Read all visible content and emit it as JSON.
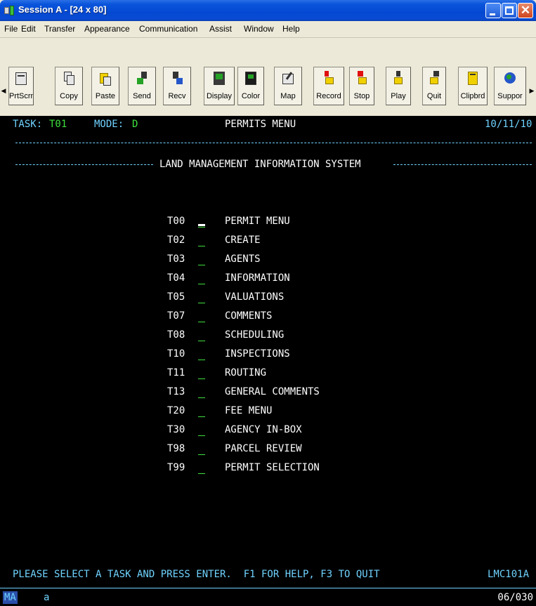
{
  "window": {
    "title": "Session A - [24 x 80]"
  },
  "menu": [
    "File",
    "Edit",
    "Transfer",
    "Appearance",
    "Communication",
    "Assist",
    "Window",
    "Help"
  ],
  "toolbar": {
    "buttons": [
      {
        "label": "PrtScrn",
        "icon": "printer-screen-icon"
      },
      {
        "label": "Copy",
        "icon": "copy-icon"
      },
      {
        "label": "Paste",
        "icon": "paste-icon"
      },
      {
        "label": "Send",
        "icon": "send-icon"
      },
      {
        "label": "Recv",
        "icon": "receive-icon"
      },
      {
        "label": "Display",
        "icon": "display-icon"
      },
      {
        "label": "Color",
        "icon": "color-icon"
      },
      {
        "label": "Map",
        "icon": "map-icon"
      },
      {
        "label": "Record",
        "icon": "record-icon"
      },
      {
        "label": "Stop",
        "icon": "stop-icon"
      },
      {
        "label": "Play",
        "icon": "play-icon"
      },
      {
        "label": "Quit",
        "icon": "quit-icon"
      },
      {
        "label": "Clipbrd",
        "icon": "clipboard-icon"
      },
      {
        "label": "Suppor",
        "icon": "support-icon"
      }
    ]
  },
  "screen": {
    "task_label": "TASK:",
    "task_value": "T01",
    "mode_label": "MODE:",
    "mode_value": "D",
    "screen_title": "PERMITS MENU",
    "date": "10/11/10",
    "system_title": "LAND MANAGEMENT INFORMATION SYSTEM",
    "options": [
      {
        "code": "T00",
        "label": "PERMIT MENU"
      },
      {
        "code": "T02",
        "label": "CREATE"
      },
      {
        "code": "T03",
        "label": "AGENTS"
      },
      {
        "code": "T04",
        "label": "INFORMATION"
      },
      {
        "code": "T05",
        "label": "VALUATIONS"
      },
      {
        "code": "T07",
        "label": "COMMENTS"
      },
      {
        "code": "T08",
        "label": "SCHEDULING"
      },
      {
        "code": "T10",
        "label": "INSPECTIONS"
      },
      {
        "code": "T11",
        "label": "ROUTING"
      },
      {
        "code": "T13",
        "label": "GENERAL COMMENTS"
      },
      {
        "code": "T20",
        "label": "FEE MENU"
      },
      {
        "code": "T30",
        "label": "AGENCY IN-BOX"
      },
      {
        "code": "T98",
        "label": "PARCEL REVIEW"
      },
      {
        "code": "T99",
        "label": "PERMIT SELECTION"
      }
    ],
    "instruction": "PLEASE SELECT A TASK AND PRESS ENTER.  F1 FOR HELP, F3 TO QUIT",
    "screen_id": "LMC101A"
  },
  "status": {
    "indicator": "MA",
    "mode_char": "a",
    "cursor_position": "06/030"
  },
  "colors": {
    "terminal_bg": "#000000",
    "text_cyan": "#6fd3ff",
    "text_white": "#ffffff",
    "field_green": "#3ee03e",
    "titlebar_blue": "#0448d2"
  }
}
